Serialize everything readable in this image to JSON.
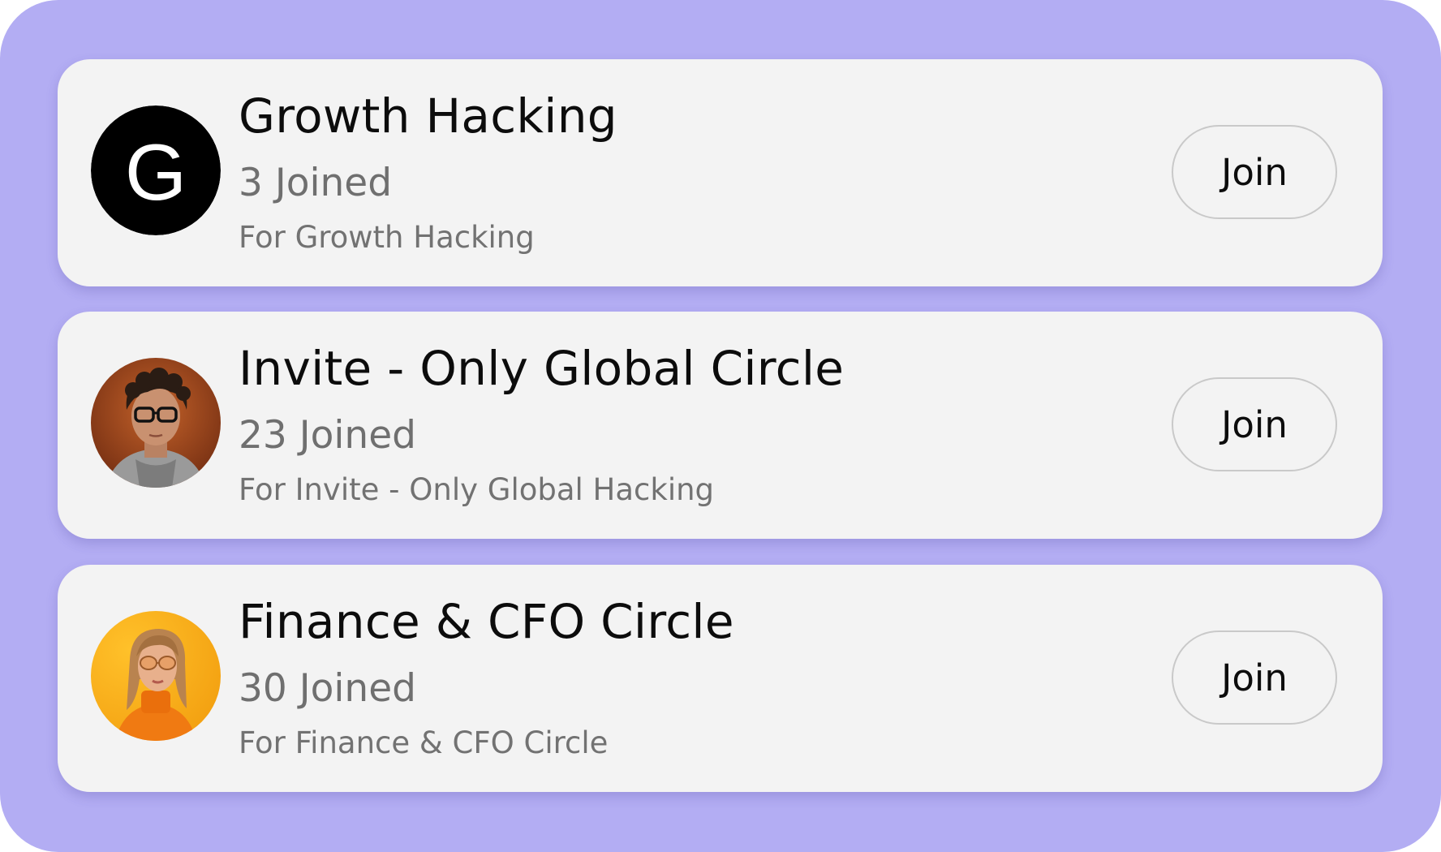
{
  "colors": {
    "background": "#b3adf3",
    "card": "#f3f3f3",
    "title": "#0c0c0c",
    "muted": "#6f6f6f",
    "button_border": "#c9c9c9"
  },
  "circles": [
    {
      "title": "Growth Hacking",
      "joined": "3 Joined",
      "description": "For Growth Hacking",
      "avatar": {
        "type": "letter",
        "letter": "G",
        "icon": "letter-g-avatar"
      },
      "join_label": "Join"
    },
    {
      "title": "Invite - Only Global Circle",
      "joined": "23 Joined",
      "description": "For Invite - Only Global Hacking",
      "avatar": {
        "type": "photo",
        "icon": "person-with-glasses-photo"
      },
      "join_label": "Join"
    },
    {
      "title": "Finance & CFO Circle",
      "joined": "30 Joined",
      "description": "For Finance & CFO Circle",
      "avatar": {
        "type": "photo",
        "icon": "woman-with-sunglasses-photo"
      },
      "join_label": "Join"
    }
  ]
}
